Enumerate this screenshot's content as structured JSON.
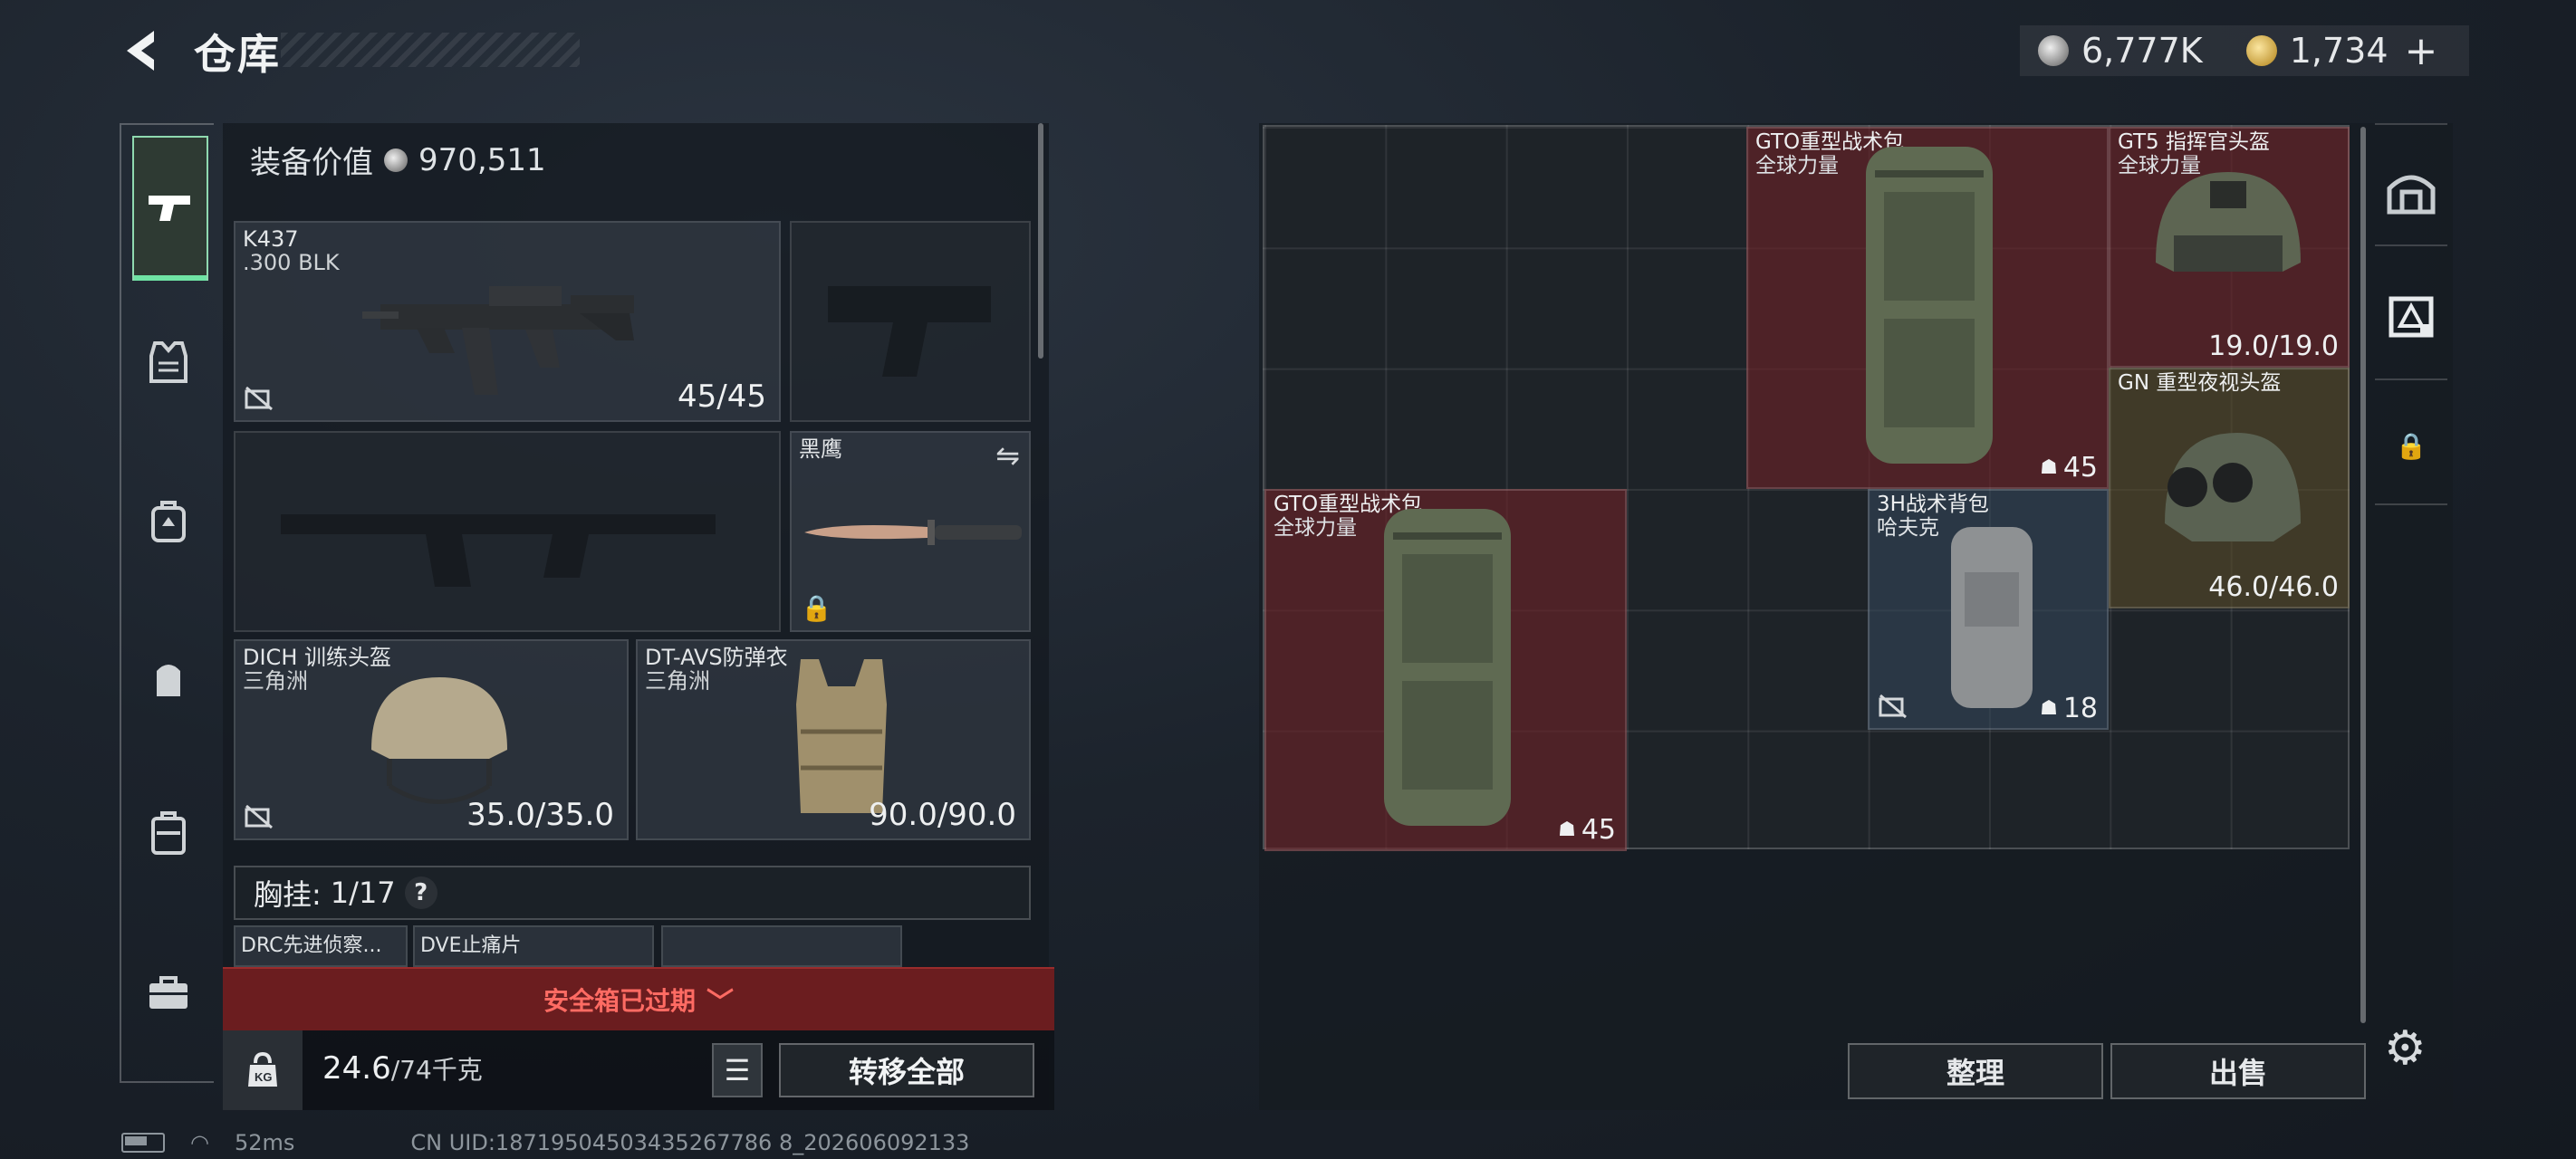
{
  "header": {
    "title": "仓库"
  },
  "currency": {
    "silver": "6,777K",
    "gold": "1,734"
  },
  "equipment": {
    "value_label": "装备价值",
    "value": "970,511",
    "primary_weapon": {
      "name": "K437",
      "caliber": ".300 BLK",
      "ammo": "45/45"
    },
    "melee": {
      "name": "黑鹰"
    },
    "helmet": {
      "name": "DICH 训练头盔",
      "brand": "三角洲",
      "durability": "35.0/35.0"
    },
    "armor": {
      "name": "DT-AVS防弹衣",
      "brand": "三角洲",
      "durability": "90.0/90.0"
    },
    "chest_rig": {
      "label": "胸挂:",
      "count": "1/17",
      "help": "?"
    },
    "chest_items": [
      {
        "name": "DRC先进侦察..."
      },
      {
        "name": "DVE止痛片"
      }
    ],
    "secure_case_status": "安全箱已过期",
    "weight_current": "24.6",
    "weight_max": "/74千克",
    "transfer_all_label": "转移全部"
  },
  "storage": {
    "items": [
      {
        "name": "GTO重型战术包",
        "sub": "全球力量",
        "count": "45",
        "rarity": "red"
      },
      {
        "name": "GT5 指挥官头盔",
        "sub": "全球力量",
        "durability": "19.0/19.0",
        "rarity": "red"
      },
      {
        "name": "GN 重型夜视头盔",
        "durability": "46.0/46.0",
        "rarity": "gold"
      },
      {
        "name": "GTO重型战术包",
        "sub": "全球力量",
        "count": "45",
        "rarity": "red"
      },
      {
        "name": "3H战术背包",
        "sub": "哈夫克",
        "count": "18",
        "rarity": "blue"
      }
    ],
    "sort_label": "整理",
    "sell_label": "出售"
  },
  "status_bar": {
    "ping": "52ms",
    "uid": "CN UID:18719504503435267786 8_202606092133"
  }
}
